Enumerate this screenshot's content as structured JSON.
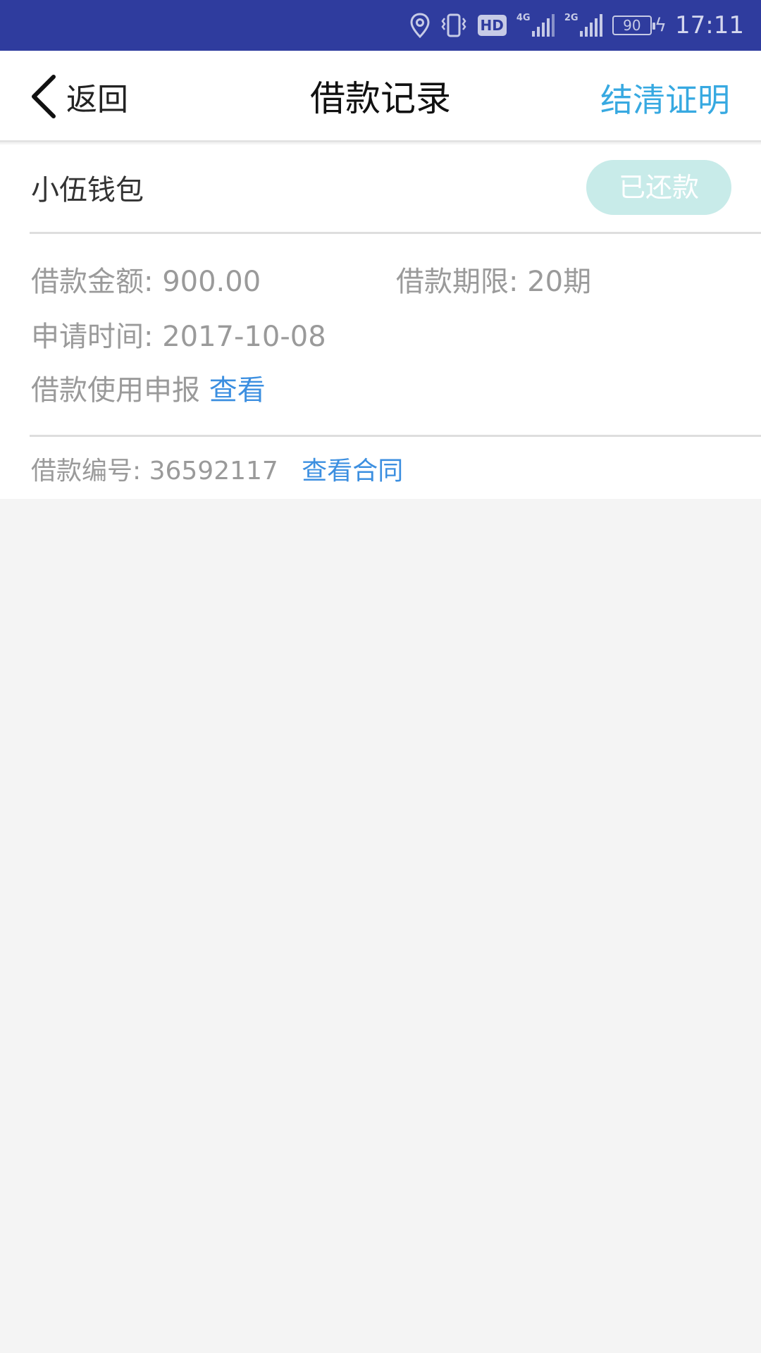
{
  "status_bar": {
    "net1_label": "4G",
    "net2_label": "2G",
    "hd_label": "HD",
    "battery": "90",
    "time": "17:11"
  },
  "nav": {
    "back_label": "返回",
    "title": "借款记录",
    "action_label": "结清证明"
  },
  "record": {
    "lender": "小伍钱包",
    "status": "已还款",
    "amount_label": "借款金额:",
    "amount_value": "900.00",
    "term_label": "借款期限:",
    "term_value": "20期",
    "date_label": "申请时间:",
    "date_value": "2017-10-08",
    "usage_label": "借款使用申报",
    "usage_link": "查看",
    "loan_no_label": "借款编号:",
    "loan_no_value": "36592117",
    "contract_link": "查看合同"
  },
  "colors": {
    "status_bar_bg": "#2f3c9e",
    "accent_blue": "#37a9e1",
    "link_blue": "#3c8fe0",
    "badge_bg": "#c8ebe9",
    "page_bg": "#f4f4f4"
  }
}
